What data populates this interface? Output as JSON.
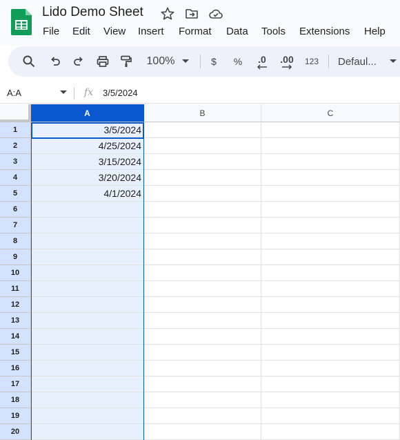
{
  "doc_title": "Lido Demo Sheet",
  "menu": [
    "File",
    "Edit",
    "View",
    "Insert",
    "Format",
    "Data",
    "Tools",
    "Extensions",
    "Help"
  ],
  "toolbar": {
    "zoom": "100%",
    "currency": "$",
    "percent": "%",
    "decrease_decimal": ".0",
    "increase_decimal": ".00",
    "number_format": "123",
    "font": "Defaul..."
  },
  "formula_bar": {
    "name_box": "A:A",
    "fx": "fx",
    "value": "3/5/2024"
  },
  "columns": [
    "A",
    "B",
    "C"
  ],
  "rows": [
    "1",
    "2",
    "3",
    "4",
    "5",
    "6",
    "7",
    "8",
    "9",
    "10",
    "11",
    "12",
    "13",
    "14",
    "15",
    "16",
    "17",
    "18",
    "19",
    "20"
  ],
  "cells_a": [
    "3/5/2024",
    "4/25/2024",
    "3/15/2024",
    "3/20/2024",
    "4/1/2024",
    "",
    "",
    "",
    "",
    "",
    "",
    "",
    "",
    "",
    "",
    "",
    "",
    "",
    "",
    ""
  ],
  "colors": {
    "accent": "#0b57d0",
    "selection": "#e8f0fe",
    "row_header_selected": "#d3e3fd",
    "sheets_green": "#0f9d58"
  }
}
